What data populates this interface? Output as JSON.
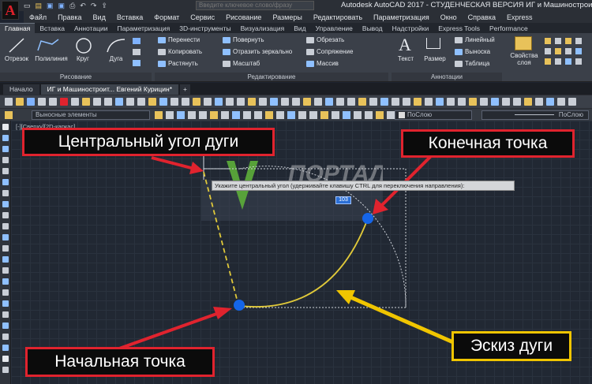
{
  "app": {
    "logo": "A",
    "search_placeholder": "Введите ключевое слово/фразу",
    "title": "Autodesk AutoCAD 2017 - СТУДЕНЧЕСКАЯ ВЕРСИЯ   ИГ и Машиностроит"
  },
  "menu": [
    "Файл",
    "Правка",
    "Вид",
    "Вставка",
    "Формат",
    "Сервис",
    "Рисование",
    "Размеры",
    "Редактировать",
    "Параметризация",
    "Окно",
    "Справка",
    "Express"
  ],
  "ribbon_tabs": [
    "Главная",
    "Вставка",
    "Аннотации",
    "Параметризация",
    "3D-инструменты",
    "Визуализация",
    "Вид",
    "Управление",
    "Вывод",
    "Надстройки",
    "Express Tools",
    "Performance"
  ],
  "ribbon": {
    "draw": {
      "line": "Отрезок",
      "polyline": "Полилиния",
      "circle": "Круг",
      "arc": "Дуга",
      "panel": "Рисование"
    },
    "modify": {
      "move": "Перенести",
      "rotate": "Повернуть",
      "trim": "Обрезать",
      "copy": "Копировать",
      "mirror": "Отразить зеркально",
      "fillet": "Сопряжение",
      "stretch": "Растянуть",
      "scale": "Масштаб",
      "array": "Массив",
      "panel": "Редактирование"
    },
    "annotation": {
      "text": "Текст",
      "dimension": "Размер",
      "linear": "Линейный",
      "leader": "Выноска",
      "table": "Таблица",
      "panel": "Аннотации"
    },
    "layers": {
      "properties": "Свойства слоя"
    }
  },
  "file_tabs": [
    "Начало",
    "ИГ и Машиностроит... Евгений Курицин*"
  ],
  "toolbar": {
    "layer_select": "Выносные элементы",
    "color_select": "ПоСлою",
    "linetype_select": "ПоСлою"
  },
  "canvas": {
    "view_label": "[-][Сверху][2D-каркас]",
    "watermark": "ПОРТАЛ",
    "prompt": "Укажите центральный угол (удерживайте клавишу CTRL для переключения направления):",
    "angle_value": "103"
  },
  "callouts": {
    "central_angle": "Центральный угол дуги",
    "end_point": "Конечная точка",
    "start_point": "Начальная точка",
    "arc_sketch": "Эскиз дуги"
  },
  "colors": {
    "callout_border": "#e0232e",
    "arrow": "#e0232e",
    "sketch_arrow": "#f0c500",
    "point": "#1565e8",
    "arc": "#e0c93a"
  }
}
